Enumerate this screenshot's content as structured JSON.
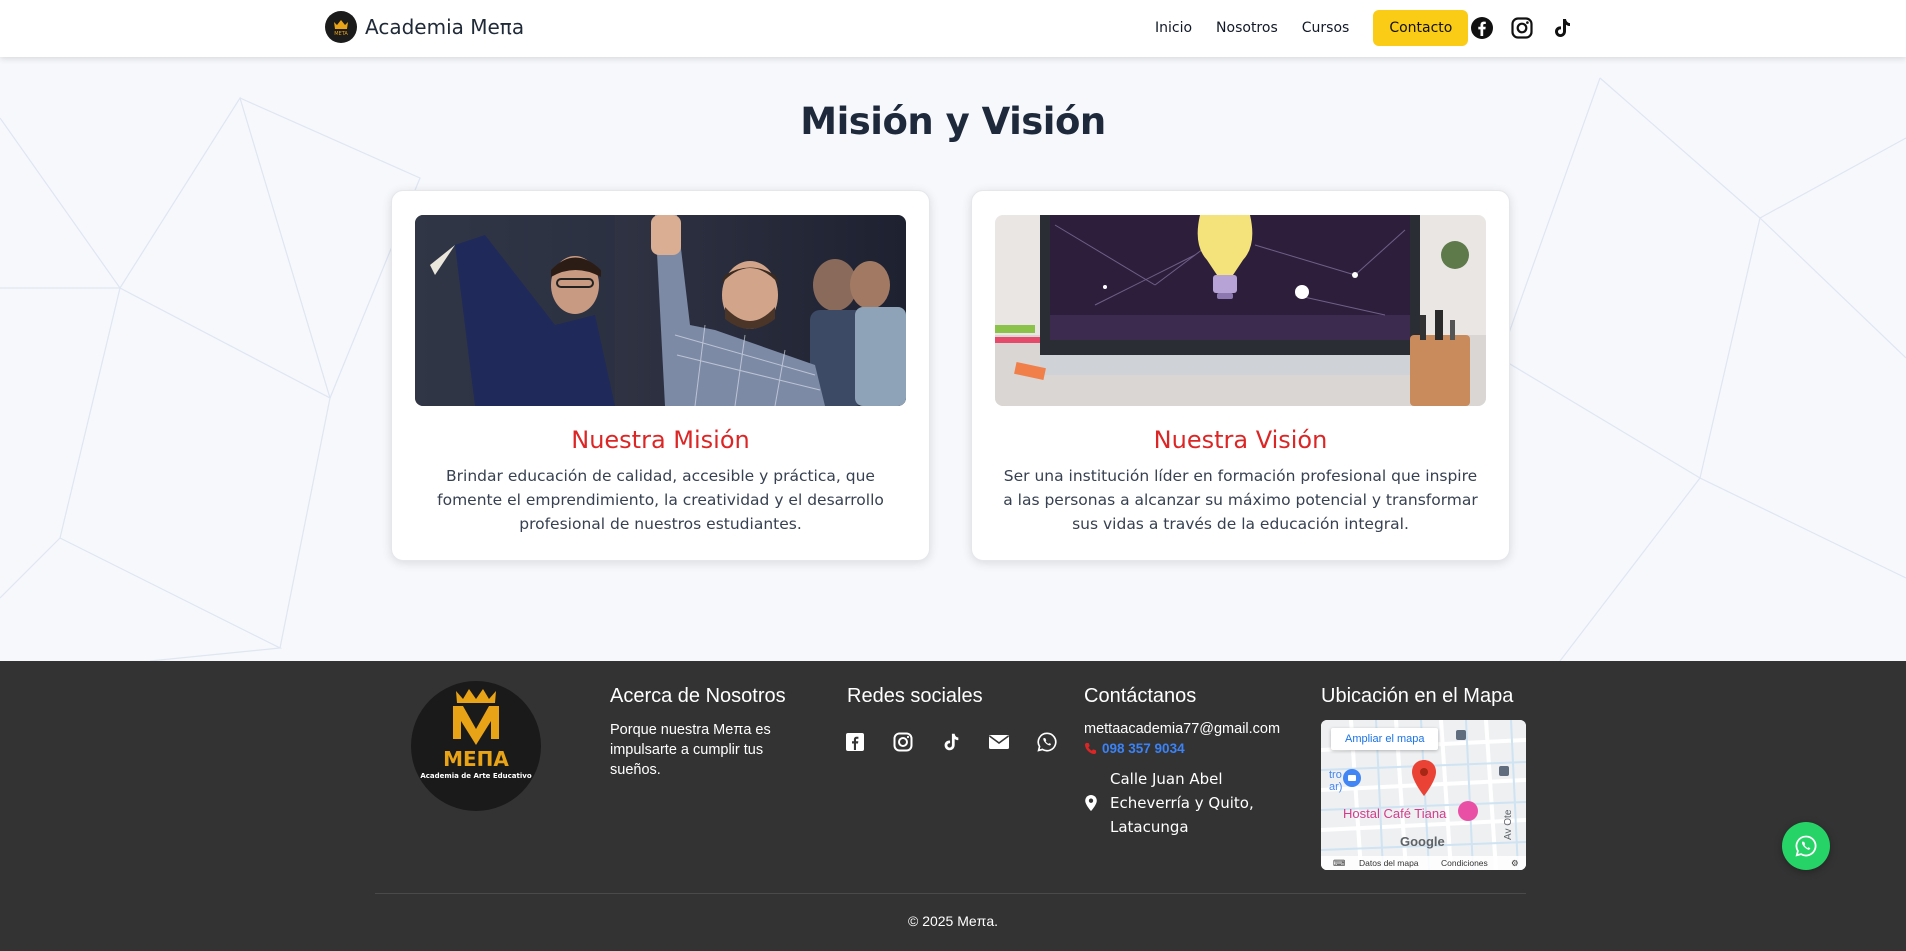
{
  "header": {
    "brand_name": "Academia Meπa",
    "nav": [
      "Inicio",
      "Nosotros",
      "Cursos"
    ],
    "contact_label": "Contacto",
    "social_icons": [
      "facebook-icon",
      "instagram-icon",
      "tiktok-icon"
    ]
  },
  "main": {
    "title": "Misión y Visión",
    "mission": {
      "title": "Nuestra Misión",
      "text": "Brindar educación de calidad, accesible y práctica, que fomente el emprendimiento, la creatividad y el desarrollo profesional de nuestros estudiantes."
    },
    "vision": {
      "title": "Nuestra Visión",
      "text": "Ser una institución líder en formación profesional que inspire a las personas a alcanzar su máximo potencial y transformar sus vidas a través de la educación integral."
    }
  },
  "footer": {
    "logo_text": "MEΠA",
    "logo_subtitle": "Academia de Arte Educativo",
    "about_title": "Acerca de Nosotros",
    "about_text": "Porque nuestra Meπa es impulsarte a cumplir tus sueños.",
    "social_title": "Redes sociales",
    "social_icons": [
      "facebook-icon",
      "instagram-icon",
      "tiktok-icon",
      "mail-icon",
      "whatsapp-icon"
    ],
    "contact_title": "Contáctanos",
    "email": "mettaacademia77@gmail.com",
    "phone": "098 357 9034",
    "address": "Calle Juan Abel Echeverría y Quito, Latacunga",
    "map_title": "Ubicación en el Mapa",
    "map": {
      "expand_label": "Ampliar el mapa",
      "place_label": "Hostal Café Tiana",
      "google_label": "Google",
      "data_label": "Datos del mapa",
      "terms_label": "Condiciones",
      "street_label": "Av Ote",
      "left_label": "tro\nar)"
    },
    "copyright": "© 2025 Meπa."
  },
  "colors": {
    "accent_yellow": "#facc15",
    "heading_red": "#dc2626",
    "footer_bg": "#333333",
    "phone_blue": "#3b82f6",
    "whatsapp_green": "#25d366"
  }
}
